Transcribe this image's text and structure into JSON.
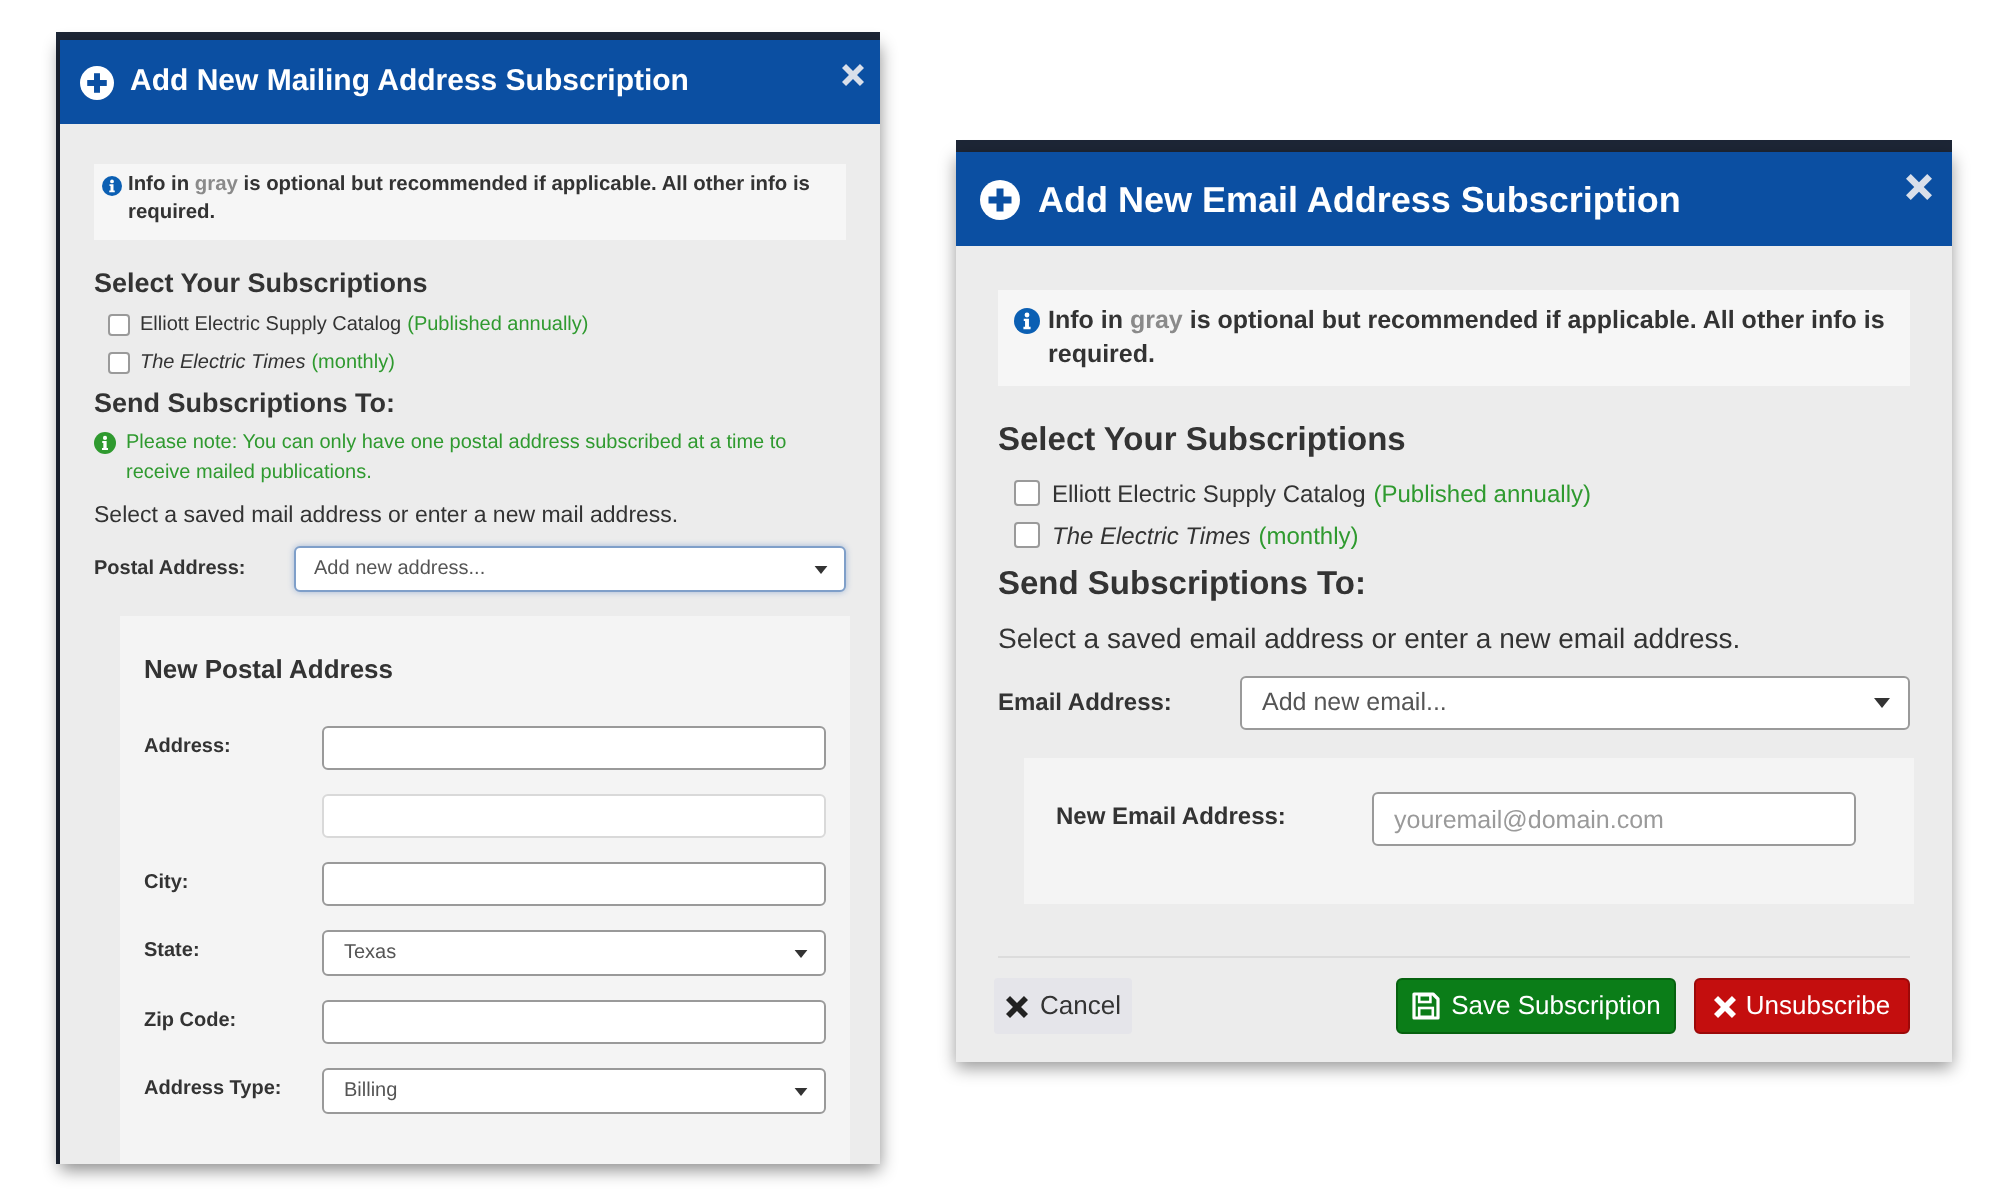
{
  "dialogs": [
    {
      "kind": "mailing",
      "title": "Add New Mailing Address Subscription",
      "info": [
        {
          "text": "Info in ",
          "muted": false
        },
        {
          "text": "gray",
          "muted": true
        },
        {
          "text": " is optional but recommended if applicable. All other info is required.",
          "muted": false
        }
      ],
      "subscriptions_heading": "Select Your Subscriptions",
      "subscriptions": [
        {
          "title": "Elliott Electric Supply Catalog",
          "italic": false,
          "frequency": "(Published annually)",
          "checked": false
        },
        {
          "title": "The Electric Times",
          "italic": true,
          "frequency": "(monthly)",
          "checked": false
        }
      ],
      "send_heading": "Send Subscriptions To:",
      "note": "Please note: You can only have one postal address subscribed at a time to receive mailed publications.",
      "instruction": "Select a saved mail address or enter a new mail address.",
      "address_field": {
        "label": "Postal Address:",
        "value": "Add new address...",
        "focused": true
      },
      "new_address": {
        "heading": "New Postal Address",
        "fields": [
          {
            "kind": "input",
            "label": "Address:",
            "optional": false
          },
          {
            "kind": "input",
            "optional": true
          },
          {
            "kind": "input",
            "label": "City:",
            "optional": false
          },
          {
            "kind": "select",
            "label": "State:",
            "value": "Texas"
          },
          {
            "kind": "input",
            "label": "Zip Code:",
            "optional": false
          },
          {
            "kind": "select",
            "label": "Address Type:",
            "value": "Billing"
          }
        ]
      }
    },
    {
      "kind": "email",
      "title": "Add New Email Address Subscription",
      "info": [
        {
          "text": "Info in ",
          "muted": false
        },
        {
          "text": "gray",
          "muted": true
        },
        {
          "text": " is optional but recommended if applicable. All other info is required.",
          "muted": false
        }
      ],
      "subscriptions_heading": "Select Your Subscriptions",
      "subscriptions": [
        {
          "title": "Elliott Electric Supply Catalog",
          "italic": false,
          "frequency": "(Published annually)",
          "checked": false
        },
        {
          "title": "The Electric Times",
          "italic": true,
          "frequency": "(monthly)",
          "checked": false
        }
      ],
      "send_heading": "Send Subscriptions To:",
      "instruction": "Select a saved email address or enter a new email address.",
      "address_field": {
        "label": "Email Address:",
        "value": "Add new email...",
        "focused": false
      },
      "new_address": {
        "fields": [
          {
            "kind": "input",
            "label": "New Email Address:",
            "placeholder": "youremail@domain.com",
            "optional": false
          }
        ]
      },
      "buttons": [
        {
          "kind": "cancel",
          "label": "Cancel"
        },
        {
          "kind": "save",
          "label": "Save Subscription"
        },
        {
          "kind": "unsubscribe",
          "label": "Unsubscribe"
        }
      ]
    }
  ]
}
